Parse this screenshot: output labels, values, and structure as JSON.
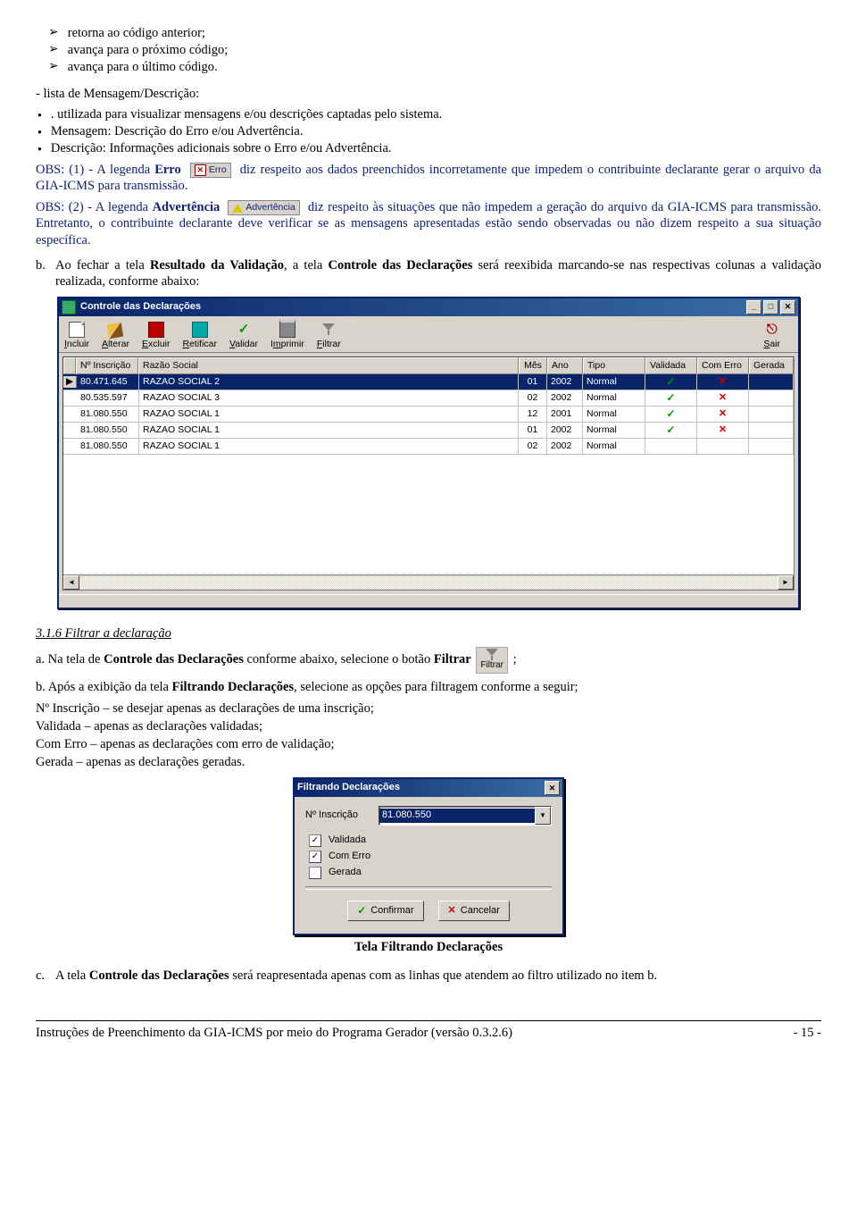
{
  "doc": {
    "arrows": [
      "retorna ao código anterior;",
      "avança para o próximo código;",
      "avança para o último código."
    ],
    "msg_head": "- lista de Mensagem/Descrição:",
    "bullets": [
      ". utilizada para visualizar mensagens e/ou descrições captadas pelo sistema.",
      "Mensagem: Descrição do Erro e/ou Advertência.",
      "Descrição: Informações adicionais sobre o Erro e/ou Advertência."
    ],
    "obs1_a": "OBS: (1) - A legenda ",
    "obs1_bold": "Erro",
    "tag_erro": "Erro",
    "obs1_b": " diz respeito aos dados preenchidos incorretamente que impedem o contribuinte declarante gerar o arquivo da GIA-ICMS para transmissão.",
    "obs2_a": "OBS: (2) - A legenda ",
    "obs2_bold": "Advertência",
    "tag_adv": "Advertência",
    "obs2_b": " diz respeito às situações que não impedem a geração do arquivo da GIA-ICMS para transmissão. Entretanto, o contribuinte declarante deve verificar se as mensagens apresentadas estão sendo observadas ou não dizem respeito a sua situação específica.",
    "item_b_letter": "b.",
    "item_b_text_1": "Ao fechar a tela ",
    "item_b_bold_1": "Resultado da Validação",
    "item_b_text_2": ", a tela ",
    "item_b_bold_2": "Controle das Declarações",
    "item_b_text_3": " será reexibida marcando-se nas respectivas colunas a validação realizada, conforme abaixo:"
  },
  "win1": {
    "title": "Controle das Declarações",
    "toolbar": {
      "incluir": "Incluir",
      "alterar": "Alterar",
      "excluir": "Excluir",
      "retificar": "Retificar",
      "validar": "Validar",
      "imprimir": "Imprimir",
      "filtrar": "Filtrar",
      "sair": "Sair"
    },
    "headers": {
      "insc": "Nº Inscrição",
      "razao": "Razão Social",
      "mes": "Mês",
      "ano": "Ano",
      "tipo": "Tipo",
      "validada": "Validada",
      "comerro": "Com Erro",
      "gerada": "Gerada"
    },
    "rows": [
      {
        "ins": "80.471.645",
        "raz": "RAZAO SOCIAL 2",
        "mes": "01",
        "ano": "2002",
        "tipo": "Normal",
        "val": true,
        "err": true,
        "sel": true
      },
      {
        "ins": "80.535.597",
        "raz": "RAZAO SOCIAL 3",
        "mes": "02",
        "ano": "2002",
        "tipo": "Normal",
        "val": true,
        "err": true,
        "sel": false
      },
      {
        "ins": "81.080.550",
        "raz": "RAZAO SOCIAL 1",
        "mes": "12",
        "ano": "2001",
        "tipo": "Normal",
        "val": true,
        "err": true,
        "sel": false
      },
      {
        "ins": "81.080.550",
        "raz": "RAZAO SOCIAL 1",
        "mes": "01",
        "ano": "2002",
        "tipo": "Normal",
        "val": true,
        "err": true,
        "sel": false
      },
      {
        "ins": "81.080.550",
        "raz": "RAZAO SOCIAL 1",
        "mes": "02",
        "ano": "2002",
        "tipo": "Normal",
        "val": false,
        "err": false,
        "sel": false
      }
    ]
  },
  "sec316": {
    "title": "3.1.6 Filtrar a declaração",
    "a_1": "a. Na tela de ",
    "a_bold": "Controle das Declarações",
    "a_2": " conforme abaixo, selecione o botão ",
    "a_bold2": "Filtrar",
    "filter_label": "Filtrar",
    "a_end": ";",
    "b_1": "b. Após a exibição da tela ",
    "b_bold": "Filtrando Declarações",
    "b_2": ", selecione as opções para filtragem conforme a seguir;",
    "lines": [
      "Nº Inscrição – se desejar apenas as declarações de uma inscrição;",
      "Validada – apenas as declarações validadas;",
      "Com Erro – apenas as declarações com erro de validação;",
      "Gerada – apenas as declarações geradas."
    ]
  },
  "dlg": {
    "title": "Filtrando Declarações",
    "insc_label": "Nº Inscrição",
    "insc_value": "81.080.550",
    "validada": "Validada",
    "comerro": "Com Erro",
    "gerada": "Gerada",
    "confirmar": "Confirmar",
    "cancelar": "Cancelar",
    "chk_validada": true,
    "chk_comerro": true,
    "chk_gerada": false
  },
  "caption": "Tela Filtrando Declarações",
  "item_c_letter": "c.",
  "item_c_1": "A tela ",
  "item_c_bold": "Controle das Declarações",
  "item_c_2": " será reapresentada apenas com as linhas que atendem ao filtro utilizado no item b.",
  "footer": {
    "left": "Instruções de Preenchimento da GIA-ICMS por meio do Programa Gerador (versão 0.3.2.6)",
    "right": "- 15 -"
  }
}
